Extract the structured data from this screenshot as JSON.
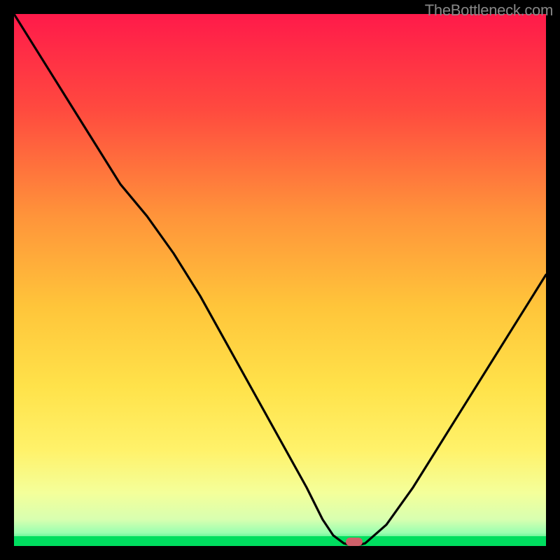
{
  "watermark": "TheBottleneck.com",
  "colors": {
    "top": "#ff1a4a",
    "mid_upper": "#ff7a3a",
    "mid": "#ffd23a",
    "mid_lower": "#ffed60",
    "lower": "#f6ffa0",
    "green": "#00de5f",
    "marker": "#d0606a",
    "curve": "#000000"
  },
  "chart_data": {
    "type": "line",
    "title": "",
    "xlabel": "",
    "ylabel": "",
    "xlim": [
      0,
      100
    ],
    "ylim": [
      0,
      100
    ],
    "x": [
      0,
      5,
      10,
      15,
      20,
      25,
      30,
      35,
      40,
      45,
      50,
      55,
      58,
      60,
      62,
      64,
      66,
      70,
      75,
      80,
      85,
      90,
      95,
      100
    ],
    "y": [
      100,
      92,
      84,
      76,
      68,
      62,
      55,
      47,
      38,
      29,
      20,
      11,
      5,
      2,
      0.5,
      0,
      0.5,
      4,
      11,
      19,
      27,
      35,
      43,
      51
    ],
    "marker": {
      "x": 64,
      "y": 0
    },
    "notes": "V-shaped bottleneck curve over red→green vertical gradient; minimum near x≈64. Values estimated from pixels (no visible axis ticks)."
  }
}
